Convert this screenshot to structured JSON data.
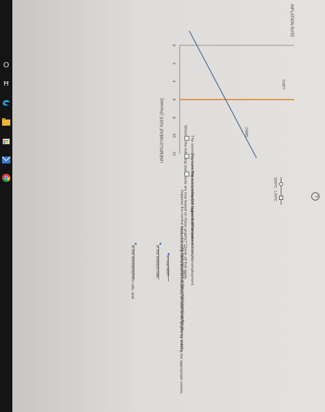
{
  "taskbar": {
    "start_glyph": "O",
    "task_view_glyph": "Ħ"
  },
  "graph": {
    "y_axis_title": "INFLATION RATE",
    "x_axis_title": "UNEMPLOYMENT RATE (Percent)",
    "x_ticks": [
      "0",
      "2",
      "4",
      "6",
      "8",
      "10",
      "12"
    ],
    "curve_labels": {
      "lrpc": "LRPC",
      "srpc": "SRPC"
    },
    "lrpc_x": 6,
    "colors": {
      "lrpc": "#e07d1f",
      "srpc": "#4b6e9a"
    }
  },
  "legend": {
    "srpc": "SRPC",
    "lrpc": "LRPC"
  },
  "help": "?",
  "question1": {
    "prompt": "Which of the following statements are true based on these graphs? Check all that apply.",
    "options": [
      "The unemployment rate is currently 6% higher than the natural rate of unemployment.",
      "The current quantity of output is greater than potential output.",
      "The natural level of output is $9 trillion."
    ]
  },
  "question2": {
    "intro": "Suppose the central bank of the economy pursues a policy that increases the money supply.",
    "instruction": "Show the long-run effects of this policy on both of the graphs by shifting the appropriate curves.",
    "sentence_start": "The long-run effect of the central bank's policy is",
    "mid1": "in the inflation rate,",
    "mid2": "in the unemployment rate, and",
    "end": "in real GDP."
  }
}
